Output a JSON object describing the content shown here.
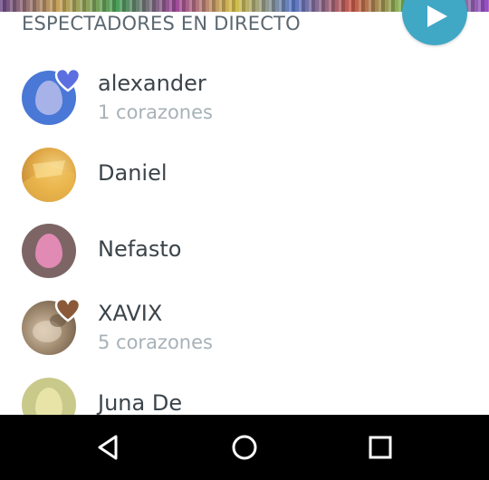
{
  "header": {
    "section_title": "ESPECTADORES EN DIRECTO",
    "play_icon": "play-icon",
    "accent_color": "#40a8c5"
  },
  "viewers": [
    {
      "name": "alexander",
      "hearts_label": "1 corazones",
      "avatar_color": "#4a78d6",
      "egg_color": "#a7b2e8",
      "heart_color": "#5c6fe0"
    },
    {
      "name": "Daniel",
      "hearts_label": "",
      "avatar_color": "#e0a840"
    },
    {
      "name": "Nefasto",
      "hearts_label": "",
      "avatar_color": "#7d6566",
      "egg_color": "#e08ab4"
    },
    {
      "name": "XAVIX",
      "hearts_label": "5 corazones",
      "avatar_color": "#8a7560",
      "heart_color": "#8a5a38"
    },
    {
      "name": "Juna De",
      "hearts_label": "",
      "avatar_color": "#c9c98a",
      "egg_color": "#e8e4a8"
    }
  ],
  "nav": {
    "back_icon": "back-triangle-icon",
    "home_icon": "home-circle-icon",
    "recents_icon": "recents-square-icon"
  }
}
